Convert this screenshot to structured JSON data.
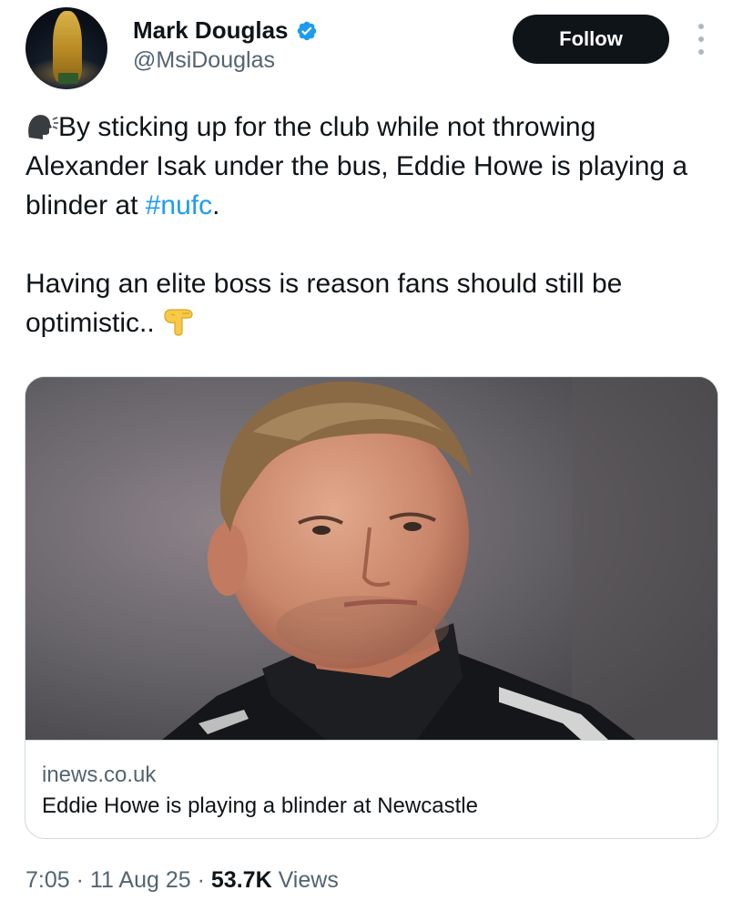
{
  "author": {
    "display_name": "Mark Douglas",
    "handle": "@MsiDouglas",
    "verified": true
  },
  "actions": {
    "follow_label": "Follow"
  },
  "tweet": {
    "paragraph1_prefix": "By sticking up for the club while not throwing Alexander Isak under the bus, Eddie Howe is playing a blinder at ",
    "hashtag": "#nufc",
    "paragraph1_suffix": ".",
    "paragraph2": "Having an elite boss is reason fans should still be optimistic.."
  },
  "link_card": {
    "domain": "inews.co.uk",
    "title": "Eddie Howe is playing a blinder at Newcastle"
  },
  "meta": {
    "time": "7:05",
    "separator": "·",
    "date": "11 Aug 25",
    "views_count": "53.7K",
    "views_label": "Views"
  },
  "colors": {
    "accent": "#1d9bf0",
    "follow_button": "#0f1419",
    "secondary_text": "#536471"
  }
}
